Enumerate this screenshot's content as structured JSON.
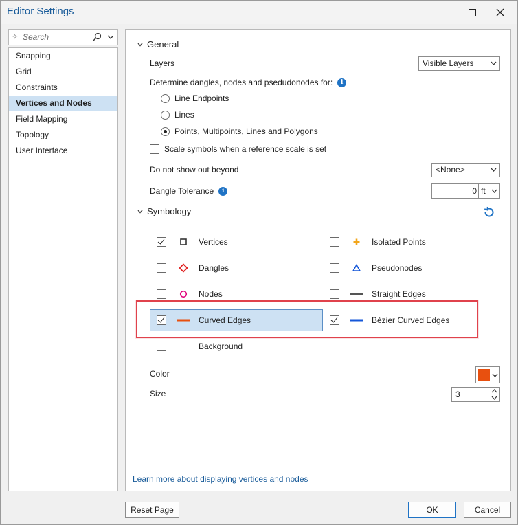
{
  "window": {
    "title": "Editor Settings"
  },
  "search": {
    "placeholder": "Search"
  },
  "nav": {
    "items": [
      {
        "label": "Snapping",
        "active": false
      },
      {
        "label": "Grid",
        "active": false
      },
      {
        "label": "Constraints",
        "active": false
      },
      {
        "label": "Vertices and Nodes",
        "active": true
      },
      {
        "label": "Field Mapping",
        "active": false
      },
      {
        "label": "Topology",
        "active": false
      },
      {
        "label": "User Interface",
        "active": false
      }
    ]
  },
  "general": {
    "heading": "General",
    "layers_label": "Layers",
    "layers_value": "Visible Layers",
    "determine_label": "Determine dangles, nodes and psedudonodes for:",
    "options": [
      {
        "label": "Line Endpoints",
        "selected": false
      },
      {
        "label": "Lines",
        "selected": false
      },
      {
        "label": "Points, Multipoints, Lines and Polygons",
        "selected": true
      }
    ],
    "scale_symbols_label": "Scale symbols when a reference scale is set",
    "scale_symbols_checked": false,
    "no_show_label": "Do not show out beyond",
    "no_show_value": "<None>",
    "dangle_tol_label": "Dangle Tolerance",
    "dangle_tol_value": "0",
    "dangle_tol_unit": "ft"
  },
  "symbology": {
    "heading": "Symbology",
    "left": [
      {
        "label": "Vertices",
        "checked": true,
        "symbol": "square"
      },
      {
        "label": "Dangles",
        "checked": false,
        "symbol": "diamond"
      },
      {
        "label": "Nodes",
        "checked": false,
        "symbol": "circle"
      },
      {
        "label": "Curved Edges",
        "checked": true,
        "symbol": "orange-line"
      },
      {
        "label": "Background",
        "checked": false,
        "symbol": "none"
      }
    ],
    "right": [
      {
        "label": "Isolated Points",
        "checked": false,
        "symbol": "plus"
      },
      {
        "label": "Pseudonodes",
        "checked": false,
        "symbol": "triangle"
      },
      {
        "label": "Straight Edges",
        "checked": false,
        "symbol": "gray-line"
      },
      {
        "label": "Bézier Curved Edges",
        "checked": true,
        "symbol": "blue-line"
      }
    ],
    "color_label": "Color",
    "color_value": "#e8500f",
    "size_label": "Size",
    "size_value": "3"
  },
  "colors": {
    "accent": "#1f73c5",
    "highlight": "#e0424c",
    "selection": "#cde1f3",
    "orange": "#e8500f",
    "blue": "#1557d8",
    "magenta": "#e0007a",
    "red": "#e02020"
  },
  "learn_more": "Learn more about displaying vertices and nodes",
  "buttons": {
    "reset": "Reset Page",
    "ok": "OK",
    "cancel": "Cancel"
  }
}
